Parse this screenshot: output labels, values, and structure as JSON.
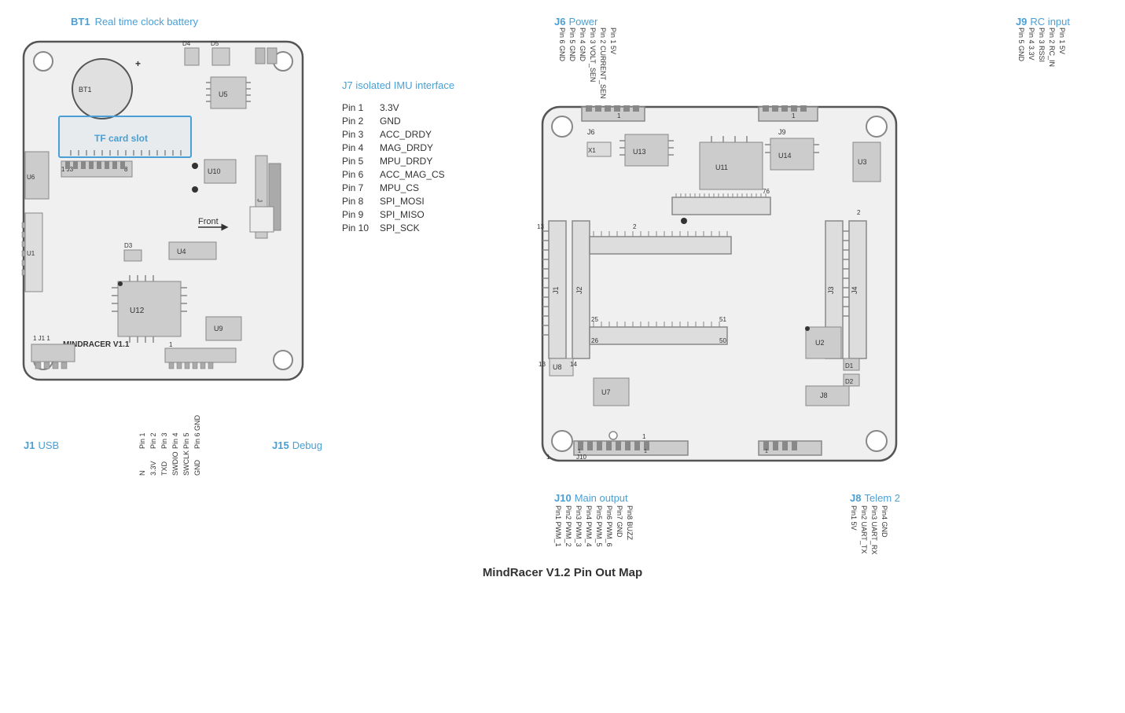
{
  "page": {
    "title": "MindRacer V1.2 Pin Out Map"
  },
  "left_board": {
    "bt1_label": "BT1",
    "bt1_desc": "Real time clock battery",
    "tf_card_label": "TF card slot",
    "j1_label": "J1",
    "j1_desc": "USB",
    "j15_label": "J15",
    "j15_desc": "Debug",
    "debug_pins": [
      "Pin1",
      "Pin2",
      "Pin3",
      "Pin4",
      "Pin5",
      "Pin6 GND"
    ],
    "debug_pin_names": [
      "N",
      "3.3V",
      "TXD",
      "SWDIO",
      "SWCLK",
      "GND"
    ],
    "board_name": "MINDRACER V1.1",
    "components": [
      "BT1",
      "D3",
      "D4",
      "D5",
      "U1",
      "U4",
      "U5",
      "U6",
      "U9",
      "U10",
      "U12",
      "J3",
      "J1"
    ]
  },
  "imu_info": {
    "title": "J7   isolated IMU interface",
    "pins": [
      {
        "num": "Pin 1",
        "name": "3.3V"
      },
      {
        "num": "Pin 2",
        "name": "GND"
      },
      {
        "num": "Pin 3",
        "name": "ACC_DRDY"
      },
      {
        "num": "Pin 4",
        "name": "MAG_DRDY"
      },
      {
        "num": "Pin 5",
        "name": "MPU_DRDY"
      },
      {
        "num": "Pin 6",
        "name": "ACC_MAG_CS"
      },
      {
        "num": "Pin 7",
        "name": "MPU_CS"
      },
      {
        "num": "Pin 8",
        "name": "SPI_MOSI"
      },
      {
        "num": "Pin 9",
        "name": "SPI_MISO"
      },
      {
        "num": "Pin 10",
        "name": "SPI_SCK"
      }
    ]
  },
  "right_board": {
    "j6_label": "J6",
    "j6_desc": "Power",
    "j6_pins": [
      "Pin 6 GND",
      "Pin 5 GND",
      "Pin 4 GND",
      "Pin 3 VOLT_SEN",
      "Pin 2 CURRENT_SEN",
      "Pin 1 5V"
    ],
    "j9_label": "J9",
    "j9_desc": "RC input",
    "j9_pins": [
      "Pin 5 GND",
      "Pin 4 3.3V",
      "Pin 3 RSSI",
      "Pin 2 RC_IN",
      "Pin 1 5V"
    ],
    "j10_label": "J10",
    "j10_desc": "Main output",
    "j10_pins": [
      "Pin1 PWM_1",
      "Pin2 PWM_2",
      "Pin3 PWM_3",
      "Pin4 PWM_4",
      "Pin5 PWM_5",
      "Pin6 PWM_6",
      "Pin7 GND",
      "Pin8 BUZZ"
    ],
    "j8_label": "J8",
    "j8_desc": "Telem 2",
    "j8_pins": [
      "Pin1 5V",
      "Pin2 UART_TX",
      "Pin3 UART_RX",
      "Pin4 GND"
    ],
    "components": [
      "X1",
      "U13",
      "U11",
      "U14",
      "U3",
      "U2",
      "U7",
      "U8",
      "D1",
      "D2",
      "J1",
      "J2",
      "J3",
      "J4",
      "J8",
      "J9",
      "J10"
    ]
  }
}
